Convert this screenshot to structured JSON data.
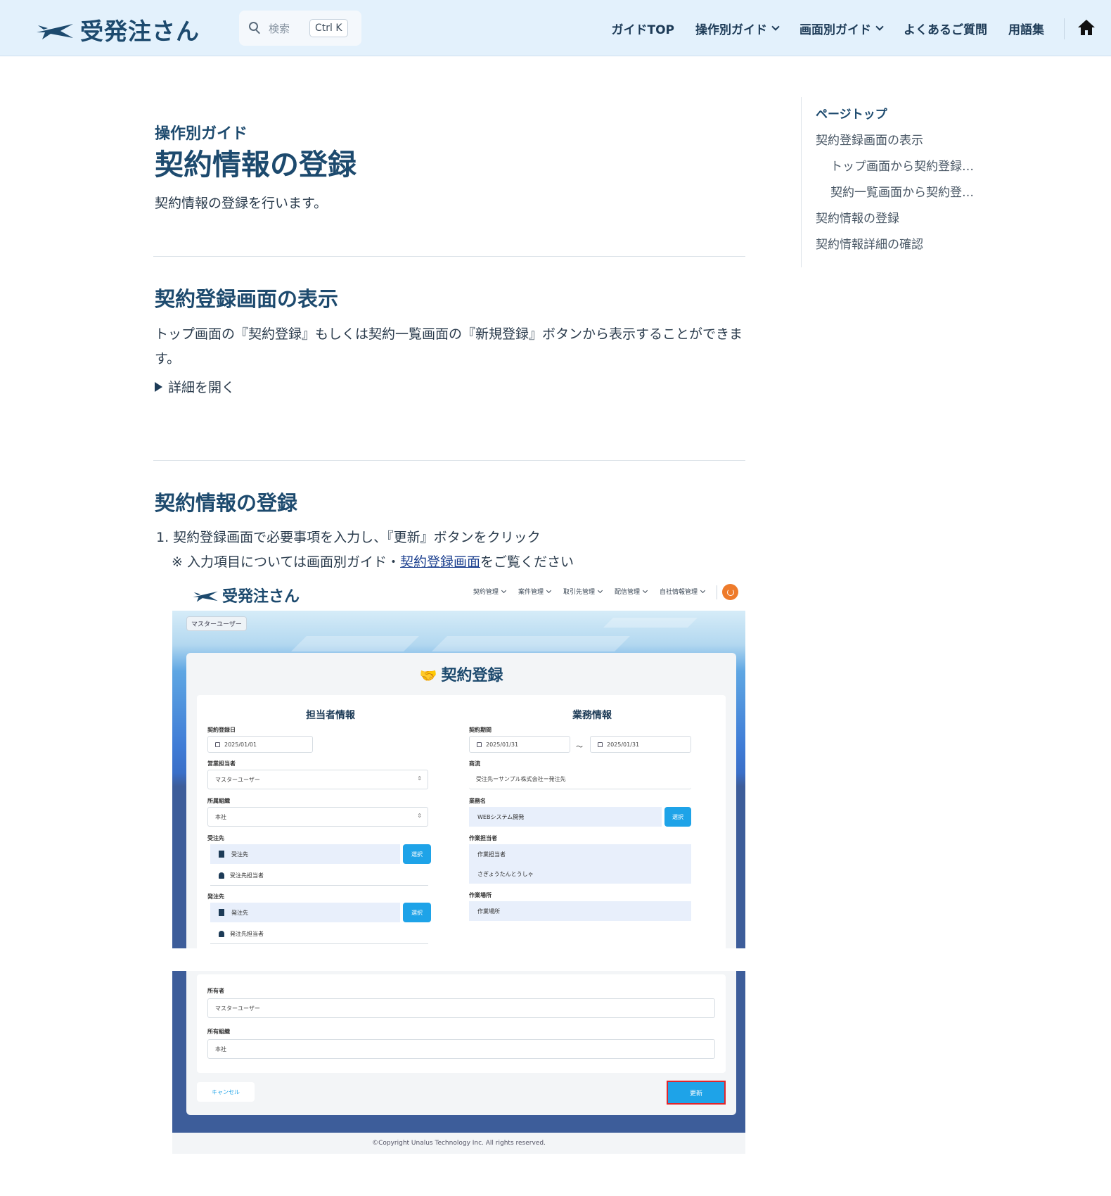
{
  "header": {
    "brand": "受発注さん",
    "search": {
      "placeholder": "検索",
      "shortcut": "Ctrl K"
    },
    "nav": [
      "ガイドTOP",
      "操作別ガイド",
      "画面別ガイド",
      "よくあるご質問",
      "用語集"
    ]
  },
  "main": {
    "kicker": "操作別ガイド",
    "title": "契約情報の登録",
    "lead": "契約情報の登録を行います。",
    "section1": {
      "heading": "契約登録画面の表示",
      "text": "トップ画面の『契約登録』もしくは契約一覧画面の『新規登録』ボタンから表示することができます。",
      "details": "詳細を開く"
    },
    "section2": {
      "heading": "契約情報の登録",
      "step1": "1. 契約登録画面で必要事項を入力し、『更新』ボタンをクリック",
      "note_prefix": "※ 入力項目については画面別ガイド・",
      "note_link": "契約登録画面",
      "note_suffix": "をご覧ください"
    }
  },
  "screenshot": {
    "brand": "受発注さん",
    "nav": [
      "契約管理",
      "案件管理",
      "取引先管理",
      "配信管理",
      "自社情報管理"
    ],
    "user_chip": "マスターユーザー",
    "title": "契約登録",
    "left_panel": {
      "title": "担当者情報",
      "contract_date_label": "契約登録日",
      "contract_date": "2025/01/01",
      "sales_label": "営業担当者",
      "sales": "マスターユーザー",
      "org_label": "所属組織",
      "org": "本社",
      "receiver_label": "受注先",
      "receiver": "受注先",
      "receiver_contact": "受注先担当者",
      "orderer_label": "発注先",
      "orderer": "発注先",
      "orderer_contact": "発注先担当者",
      "select": "選択"
    },
    "right_panel": {
      "title": "業務情報",
      "period_label": "契約期間",
      "period_start": "2025/01/31",
      "tilde": "～",
      "period_end": "2025/01/31",
      "flow_label": "商流",
      "flow": "受注先ーサンプル株式会社ー発注先",
      "job_label": "業務名",
      "job": "WEBシステム開発",
      "worker_label": "作業担当者",
      "worker": "作業担当者",
      "worker_kana": "さぎょうたんとうしゃ",
      "place_label": "作業場所",
      "place": "作業場所",
      "select": "選択"
    },
    "owner_label": "所有者",
    "owner": "マスターユーザー",
    "owner_org_label": "所有組織",
    "owner_org": "本社",
    "cancel": "キャンセル",
    "update": "更新",
    "footer": "©Copyright Unalus Technology Inc. All rights reserved."
  },
  "toc": {
    "items": [
      "ページトップ",
      "契約登録画面の表示",
      "トップ画面から契約登録…",
      "契約一覧画面から契約登…",
      "契約情報の登録",
      "契約情報詳細の確認"
    ]
  }
}
